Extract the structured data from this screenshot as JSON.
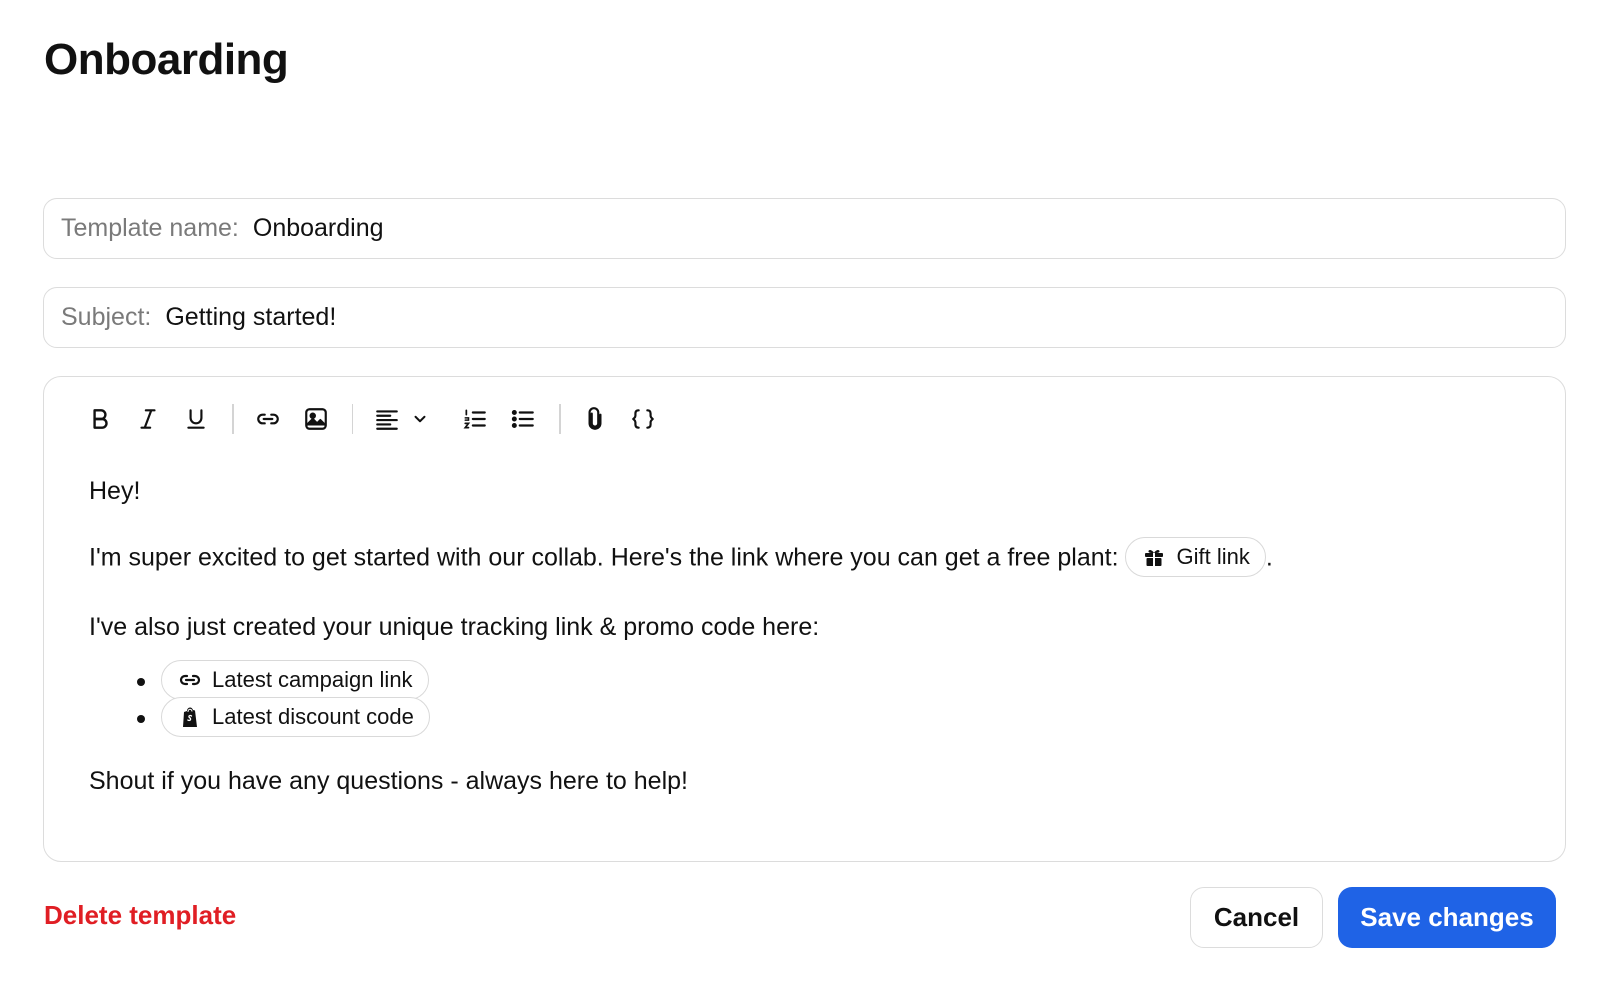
{
  "page": {
    "title": "Onboarding"
  },
  "template_field": {
    "label": "Template name:",
    "value": "Onboarding"
  },
  "subject_field": {
    "label": "Subject:",
    "value": "Getting started!"
  },
  "toolbar": {
    "icons": [
      "bold-icon",
      "italic-icon",
      "underline-icon",
      "link-icon",
      "image-icon",
      "align-left-icon",
      "chevron-down-icon",
      "numbered-list-icon",
      "bullet-list-icon",
      "attachment-icon",
      "variables-icon"
    ]
  },
  "body": {
    "greeting": "Hey!",
    "line1_text": "I'm super excited to get started with our collab. Here's the link where you can get a free plant: ",
    "gift_chip": {
      "icon": "gift-icon",
      "label": "Gift link"
    },
    "line1_end": ".",
    "line2_text": "I've also just created your unique tracking link & promo code here:",
    "bullets": [
      {
        "icon": "link-icon",
        "label": "Latest campaign link"
      },
      {
        "icon": "shopify-bag-icon",
        "label": "Latest discount code"
      }
    ],
    "closing": "Shout if you have any questions - always here to help!"
  },
  "footer": {
    "delete_label": "Delete template",
    "cancel_label": "Cancel",
    "save_label": "Save changes"
  },
  "colors": {
    "danger": "#e01e24",
    "primary": "#1f63e6",
    "border": "#dcdcdc"
  }
}
